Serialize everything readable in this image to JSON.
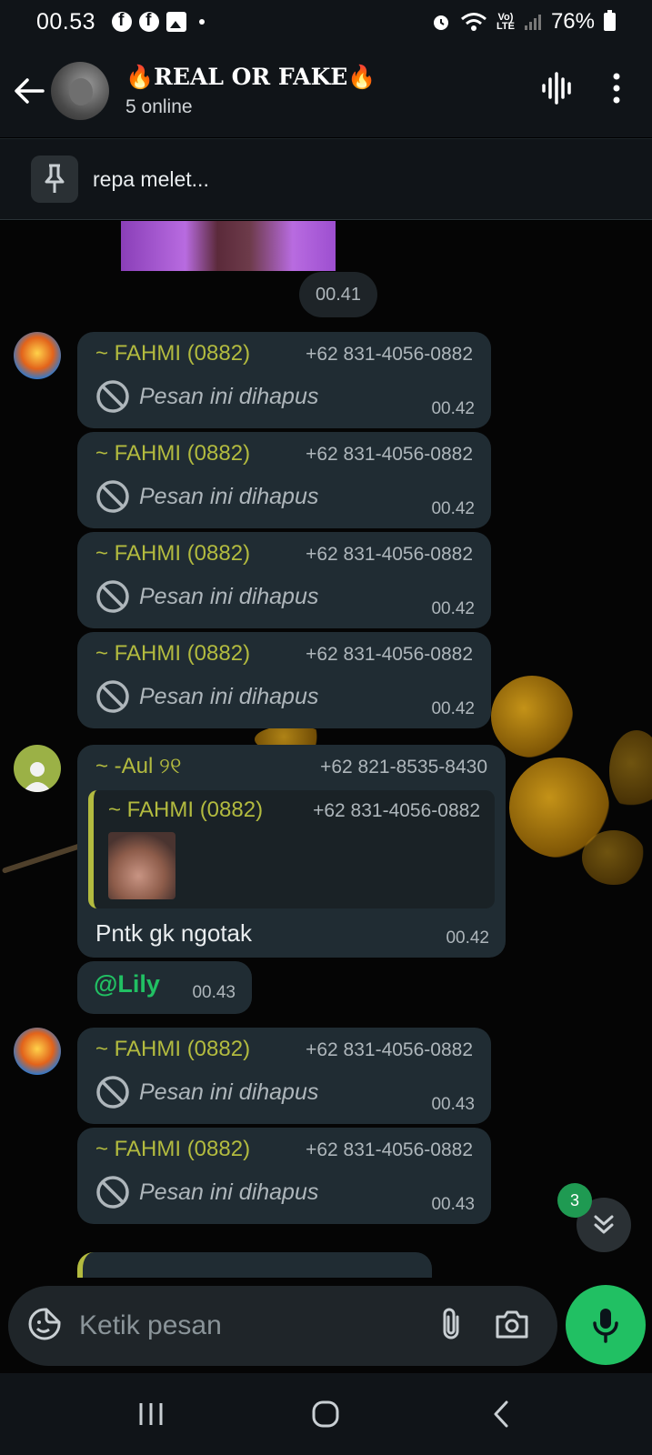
{
  "status_bar": {
    "time": "00.53",
    "network_label": "Vo)\nLTE",
    "battery": "76%"
  },
  "header": {
    "title": "🔥REAL OR FAKE🔥",
    "subtitle": "5 online"
  },
  "pinned": {
    "text": "repa melet..."
  },
  "chat": {
    "date_chip": "00.41",
    "messages": [
      {
        "sender": "~ FAHMI (0882)",
        "phone": "+62 831-4056-0882",
        "text": "Pesan ini dihapus",
        "time": "00.42"
      },
      {
        "sender": "~ FAHMI (0882)",
        "phone": "+62 831-4056-0882",
        "text": "Pesan ini dihapus",
        "time": "00.42"
      },
      {
        "sender": "~ FAHMI (0882)",
        "phone": "+62 831-4056-0882",
        "text": "Pesan ini dihapus",
        "time": "00.42"
      },
      {
        "sender": "~ FAHMI (0882)",
        "phone": "+62 831-4056-0882",
        "text": "Pesan ini dihapus",
        "time": "00.42"
      },
      {
        "sender": "~ -Aul ୨୧",
        "phone": "+62 821-8535-8430",
        "quote": {
          "sender": "~ FAHMI (0882)",
          "phone": "+62 831-4056-0882"
        },
        "text": "Pntk gk ngotak",
        "time": "00.42"
      },
      {
        "text": "@Lily",
        "time": "00.43"
      },
      {
        "sender": "~ FAHMI (0882)",
        "phone": "+62 831-4056-0882",
        "text": "Pesan ini dihapus",
        "time": "00.43"
      },
      {
        "sender": "~ FAHMI (0882)",
        "phone": "+62 831-4056-0882",
        "text": "Pesan ini dihapus",
        "time": "00.43"
      }
    ],
    "unread_count": "3"
  },
  "composer": {
    "placeholder": "Ketik pesan"
  },
  "colors": {
    "accent_green": "#21c063",
    "sender_yellow": "#b3bb3f",
    "bubble": "#202c33"
  }
}
